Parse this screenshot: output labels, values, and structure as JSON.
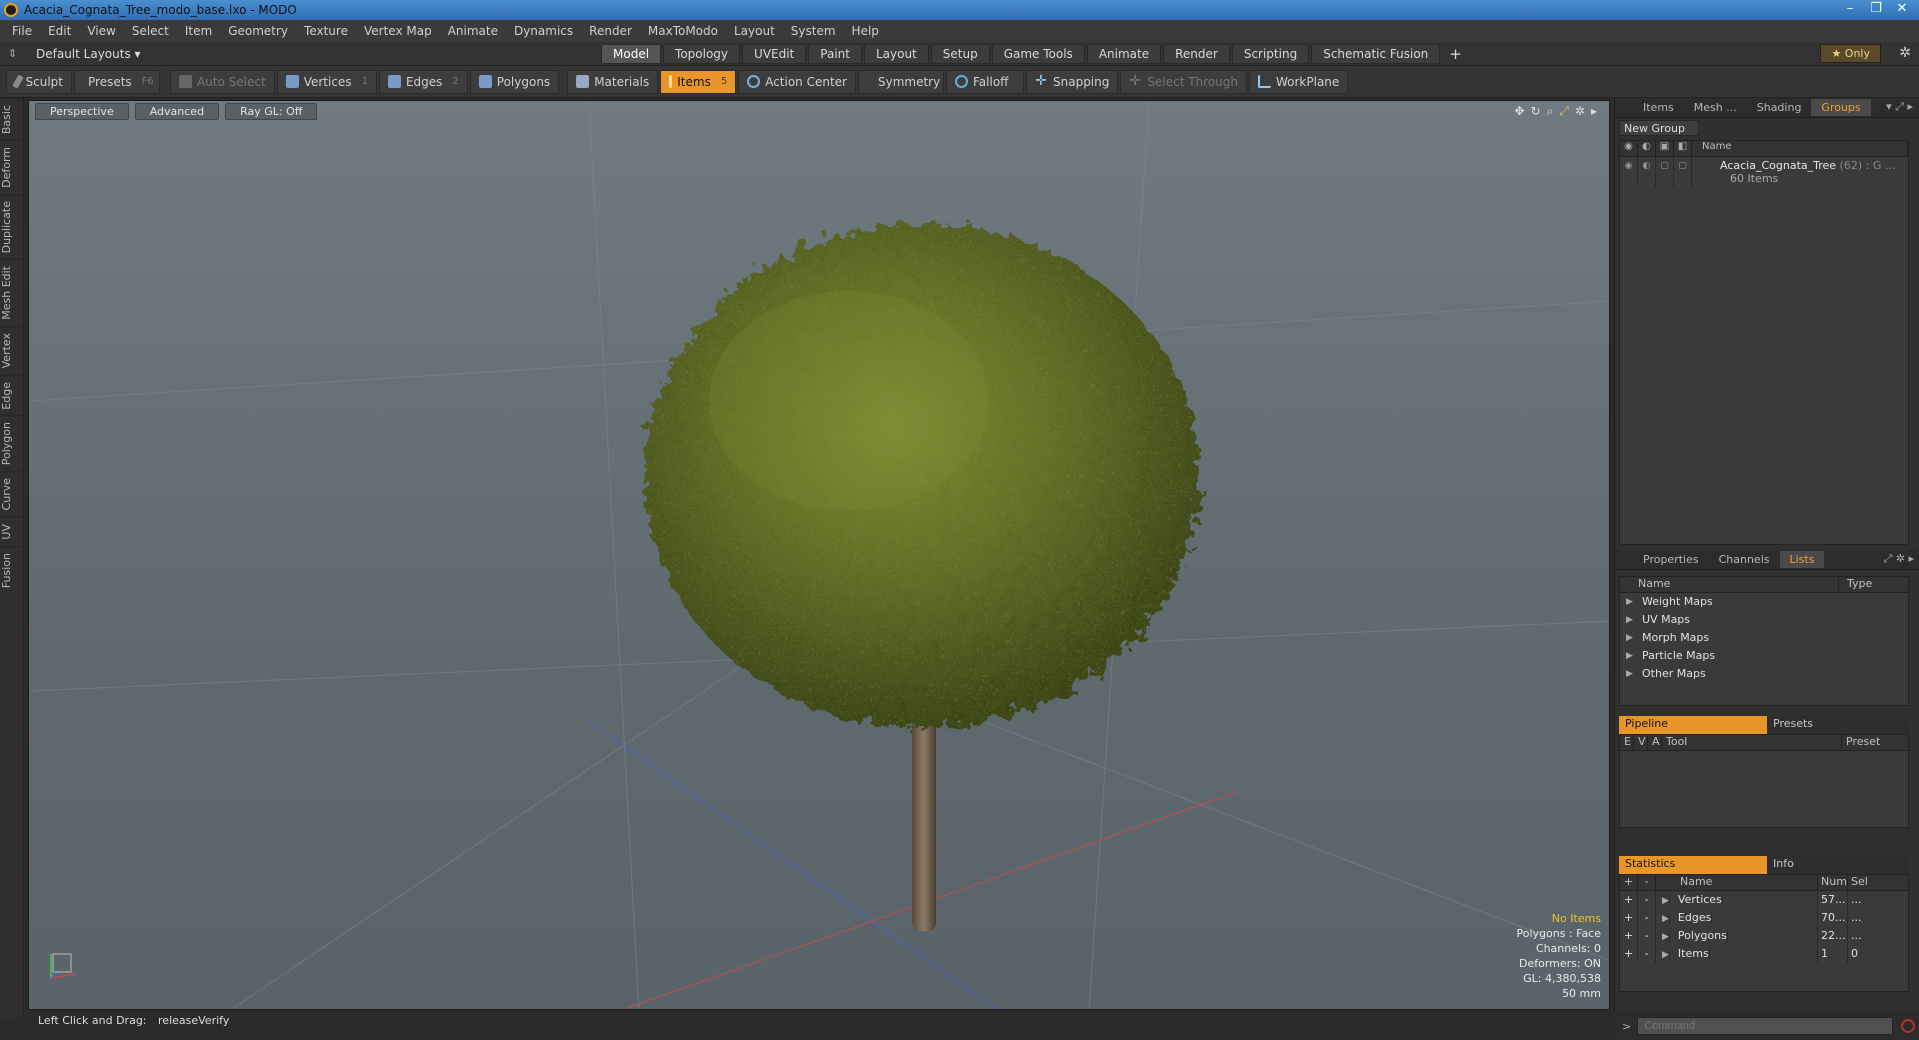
{
  "window": {
    "title": "Acacia_Cognata_Tree_modo_base.lxo - MODO",
    "controls": [
      "–",
      "❐",
      "✕"
    ]
  },
  "menu": [
    "File",
    "Edit",
    "View",
    "Select",
    "Item",
    "Geometry",
    "Texture",
    "Vertex Map",
    "Animate",
    "Dynamics",
    "Render",
    "MaxToModo",
    "Layout",
    "System",
    "Help"
  ],
  "layoutbar": {
    "layouts_label": "Default Layouts ▾",
    "tabs": [
      "Model",
      "Topology",
      "UVEdit",
      "Paint",
      "Layout",
      "Setup",
      "Game Tools",
      "Animate",
      "Render",
      "Scripting",
      "Schematic Fusion"
    ],
    "active_tab": "Model",
    "only_label": "★  Only"
  },
  "toolbar": {
    "sculpt": "Sculpt",
    "presets": "Presets",
    "presets_key": "F6",
    "auto_select": "Auto Select",
    "vertices": "Vertices",
    "vertices_key": "1",
    "edges": "Edges",
    "edges_key": "2",
    "polygons": "Polygons",
    "materials": "Materials",
    "items": "Items",
    "items_key": "5",
    "action_center": "Action Center",
    "symmetry": "Symmetry",
    "falloff": "Falloff",
    "snapping": "Snapping",
    "select_through": "Select Through",
    "workplane": "WorkPlane"
  },
  "leftstrip": [
    "Basic",
    "Deform",
    "Duplicate",
    "Mesh Edit",
    "Vertex",
    "Edge",
    "Polygon",
    "Curve",
    "UV",
    "Fusion"
  ],
  "viewport": {
    "perspective": "Perspective",
    "advanced": "Advanced",
    "raygl": "Ray GL: Off",
    "stats": {
      "no_items": "No Items",
      "polygons": "Polygons : Face",
      "channels": "Channels: 0",
      "deformers": "Deformers: ON",
      "gl": "GL: 4,380,538",
      "scale": "50 mm"
    }
  },
  "status": {
    "hint": "Left Click and Drag:",
    "action": "releaseVerify"
  },
  "groups_panel": {
    "tabs": [
      "Items",
      "Mesh ...",
      "Shading",
      "Groups"
    ],
    "active": "Groups",
    "new_group": "New Group",
    "col_name": "Name",
    "item_name": "Acacia_Cognata_Tree",
    "item_suffix": "(62) : G ...",
    "item_count": "60 Items"
  },
  "lists_panel": {
    "tabs": [
      "Properties",
      "Channels",
      "Lists"
    ],
    "active": "Lists",
    "col_name": "Name",
    "col_type": "Type",
    "rows": [
      "Weight Maps",
      "UV Maps",
      "Morph Maps",
      "Particle Maps",
      "Other Maps"
    ]
  },
  "pipeline_panel": {
    "tab_a": "Pipeline",
    "tab_b": "Presets",
    "cols": [
      "E",
      "V",
      "A",
      "Tool",
      "Preset"
    ]
  },
  "stats_panel": {
    "tab_a": "Statistics",
    "tab_b": "Info",
    "cols": [
      "+",
      "-",
      "Name",
      "Num",
      "Sel"
    ],
    "rows": [
      {
        "name": "Vertices",
        "num": "57...",
        "sel": "..."
      },
      {
        "name": "Edges",
        "num": "70...",
        "sel": "..."
      },
      {
        "name": "Polygons",
        "num": "22...",
        "sel": "..."
      },
      {
        "name": "Items",
        "num": "1",
        "sel": "0"
      }
    ]
  },
  "command": {
    "placeholder": "Command"
  },
  "colors": {
    "accent": "#e8962a",
    "foliage": "#5e6a25",
    "trunk": "#6b5a48"
  }
}
